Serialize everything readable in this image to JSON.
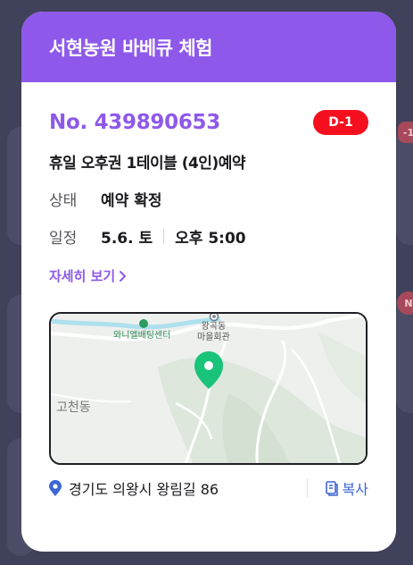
{
  "modal": {
    "title": "서현농원 바베큐 체험",
    "booking_number": "No. 439890653",
    "dday_badge": "D-1",
    "product": "휴일 오후권 1테이블 (4인)예약",
    "status": {
      "label": "상태",
      "value": "예약 확정"
    },
    "schedule": {
      "label": "일정",
      "date": "5.6. 토",
      "time": "오후 5:00"
    },
    "detail_link": "자세히 보기",
    "map": {
      "poi_1": "와니엘배팅센터",
      "poi_2_line1": "왕곡동",
      "poi_2_line2": "마을회관",
      "district": "고천동"
    },
    "address": "경기도 의왕시 왕림길 86",
    "copy_label": "복사"
  },
  "background": {
    "badge_1": "-1",
    "badge_2": "N"
  },
  "colors": {
    "accent": "#8e59ea",
    "badge_red": "#f5101f",
    "pin_green": "#19c37a",
    "copy_blue": "#3d66d4"
  }
}
